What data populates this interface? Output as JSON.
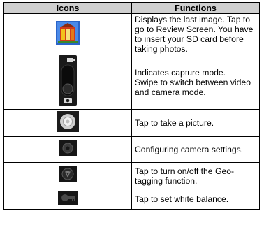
{
  "table": {
    "headers": {
      "icons": "Icons",
      "functions": "Functions"
    },
    "rows": [
      {
        "icon": "last-image-thumbnail-icon",
        "text": "Displays the last image. Tap to go to Review Screen. You have to insert your SD card before taking photos."
      },
      {
        "icon": "capture-mode-switch-icon",
        "text": "Indicates capture mode.\nSwipe to switch between video and camera mode."
      },
      {
        "icon": "shutter-icon",
        "text": "Tap to take a picture."
      },
      {
        "icon": "camera-settings-icon",
        "text": "Configuring camera settings."
      },
      {
        "icon": "geo-tagging-icon",
        "text": "Tap to turn on/off the Geo-tagging function."
      },
      {
        "icon": "white-balance-icon",
        "text": "Tap to set white balance."
      }
    ]
  }
}
